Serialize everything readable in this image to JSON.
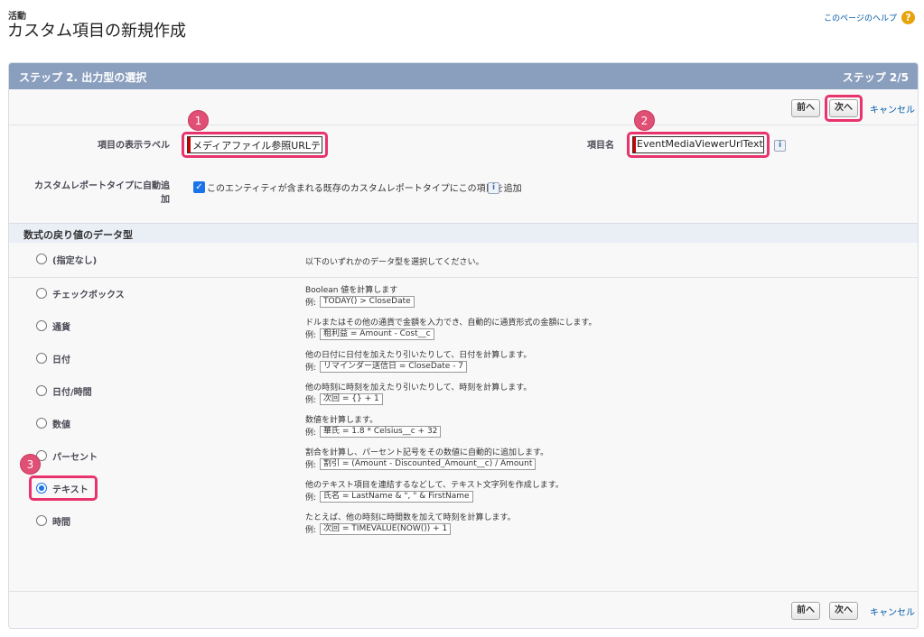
{
  "header": {
    "object_type": "活動",
    "title": "カスタム項目の新規作成",
    "help_link": "このページのヘルプ",
    "help_icon": "help-icon"
  },
  "wizard": {
    "step_title": "ステップ 2. 出力型の選択",
    "step_count": "ステップ 2/5",
    "prev_label": "前へ",
    "next_label": "次へ",
    "cancel_label": "キャンセル"
  },
  "form": {
    "label_field_label": "項目の表示ラベル",
    "label_field_value": "メディアファイル参照URLテキ",
    "name_field_label": "項目名",
    "name_field_value": "EventMediaViewerUrlText",
    "auto_add_label": "カスタムレポートタイプに自動追加",
    "auto_add_text": "このエンティティが含まれる既存のカスタムレポートタイプにこの項目を追加",
    "auto_add_checked": true
  },
  "section": {
    "title": "数式の戻り値のデータ型"
  },
  "example_prefix": "例:",
  "options": [
    {
      "label": "(指定なし)",
      "desc": "以下のいずれかのデータ型を選択してください。",
      "example": "",
      "selected": false
    },
    {
      "label": "チェックボックス",
      "desc": "Boolean 値を計算します",
      "example": "TODAY() > CloseDate",
      "selected": false
    },
    {
      "label": "通貨",
      "desc": "ドルまたはその他の通貨で金額を入力でき、自動的に通貨形式の金額にします。",
      "example": "粗利益 = Amount - Cost__c",
      "selected": false
    },
    {
      "label": "日付",
      "desc": "他の日付に日付を加えたり引いたりして、日付を計算します。",
      "example": "リマインダー送信日 = CloseDate - 7",
      "selected": false
    },
    {
      "label": "日付/時間",
      "desc": "他の時刻に時刻を加えたり引いたりして、時刻を計算します。",
      "example": "次回 = {} + 1",
      "selected": false
    },
    {
      "label": "数値",
      "desc": "数値を計算します。",
      "example": "華氏 = 1.8 * Celsius__c + 32",
      "selected": false
    },
    {
      "label": "パーセント",
      "desc": "割合を計算し、パーセント記号をその数値に自動的に追加します。",
      "example": "割引 = (Amount - Discounted_Amount__c) / Amount",
      "selected": false
    },
    {
      "label": "テキスト",
      "desc": "他のテキスト項目を連結するなどして、テキスト文字列を作成します。",
      "example": "氏名 = LastName & \", \" & FirstName",
      "selected": true
    },
    {
      "label": "時間",
      "desc": "たとえば、他の時刻に時間数を加えて時刻を計算します。",
      "example": "次回 = TIMEVALUE(NOW()) + 1",
      "selected": false
    }
  ],
  "annotations": [
    "1",
    "2",
    "3"
  ],
  "colors": {
    "panel_header": "#8a9ebe",
    "highlight": "#e8336d",
    "badge": "#e04f74",
    "link": "#015ba7",
    "radio_selected": "#1a73e8"
  }
}
